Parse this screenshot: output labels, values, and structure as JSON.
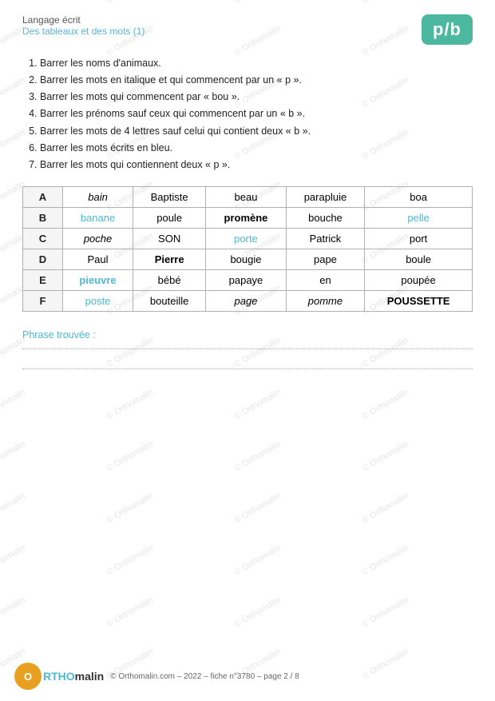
{
  "header": {
    "subject": "Langage écrit",
    "title": "Des tableaux et des mots (1)",
    "badge": "p/b"
  },
  "instructions": {
    "items": [
      "Barrer les noms d'animaux.",
      "Barrer les mots en italique et qui commencent par un « p ».",
      "Barrer les mots qui commencent par « bou ».",
      "Barrer les prénoms sauf ceux qui commencent par un « b ».",
      "Barrer les mots de 4 lettres sauf celui qui contient deux « b ».",
      "Barrer les mots écrits en bleu.",
      "Barrer les mots qui contiennent deux « p »."
    ]
  },
  "table": {
    "rows": [
      {
        "label": "A",
        "cells": [
          {
            "text": "bain",
            "style": "italic"
          },
          {
            "text": "Baptiste",
            "style": "normal"
          },
          {
            "text": "beau",
            "style": "normal"
          },
          {
            "text": "parapluie",
            "style": "normal"
          },
          {
            "text": "boa",
            "style": "normal"
          }
        ]
      },
      {
        "label": "B",
        "cells": [
          {
            "text": "banane",
            "style": "blue"
          },
          {
            "text": "poule",
            "style": "normal"
          },
          {
            "text": "promène",
            "style": "bold"
          },
          {
            "text": "bouche",
            "style": "normal"
          },
          {
            "text": "pelle",
            "style": "blue"
          }
        ]
      },
      {
        "label": "C",
        "cells": [
          {
            "text": "poche",
            "style": "italic"
          },
          {
            "text": "SON",
            "style": "uppercase"
          },
          {
            "text": "porte",
            "style": "blue"
          },
          {
            "text": "Patrick",
            "style": "normal"
          },
          {
            "text": "port",
            "style": "normal"
          }
        ]
      },
      {
        "label": "D",
        "cells": [
          {
            "text": "Paul",
            "style": "normal"
          },
          {
            "text": "Pierre",
            "style": "bold"
          },
          {
            "text": "bougie",
            "style": "normal"
          },
          {
            "text": "pape",
            "style": "normal"
          },
          {
            "text": "boule",
            "style": "normal"
          }
        ]
      },
      {
        "label": "E",
        "cells": [
          {
            "text": "pieuvre",
            "style": "bold-blue"
          },
          {
            "text": "bébé",
            "style": "normal"
          },
          {
            "text": "papaye",
            "style": "normal"
          },
          {
            "text": "en",
            "style": "normal"
          },
          {
            "text": "poupée",
            "style": "normal"
          }
        ]
      },
      {
        "label": "F",
        "cells": [
          {
            "text": "poste",
            "style": "blue"
          },
          {
            "text": "bouteille",
            "style": "normal"
          },
          {
            "text": "page",
            "style": "italic"
          },
          {
            "text": "pomme",
            "style": "italic"
          },
          {
            "text": "POUSSETTE",
            "style": "uppercase-bold"
          }
        ]
      }
    ]
  },
  "phrase": {
    "label": "Phrase trouvée :"
  },
  "footer": {
    "logo_ortho": "ORTHO",
    "logo_malin": "malin",
    "info": "© Orthomalin.com – 2022 – fiche n°3780 – page 2 / 8"
  }
}
